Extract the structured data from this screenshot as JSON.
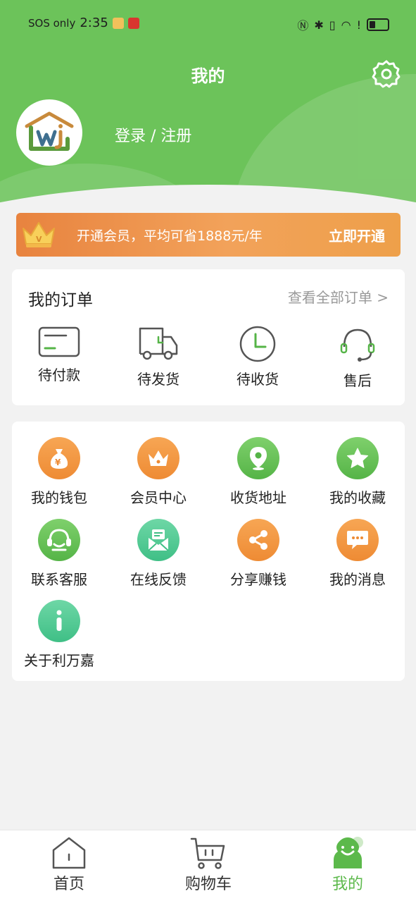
{
  "status_bar": {
    "carrier": "SOS only",
    "time": "2:35"
  },
  "header": {
    "title": "我的",
    "login_text": "登录 / 注册",
    "settings_icon": "gear-icon",
    "avatar_logo": "liwanjia-logo"
  },
  "vip_banner": {
    "promo": "开通会员，平均可省1888元/年",
    "action": "立即开通",
    "icon": "crown-icon"
  },
  "orders": {
    "title": "我的订单",
    "view_all": "查看全部订单 >",
    "items": [
      {
        "label": "待付款",
        "icon": "card-icon"
      },
      {
        "label": "待发货",
        "icon": "truck-icon"
      },
      {
        "label": "待收货",
        "icon": "clock-icon"
      },
      {
        "label": "售后",
        "icon": "headset-icon"
      }
    ]
  },
  "tools": [
    {
      "label": "我的钱包",
      "icon": "money-bag-icon",
      "color": "#f29a45"
    },
    {
      "label": "会员中心",
      "icon": "crown-icon",
      "color": "#f29a45"
    },
    {
      "label": "收货地址",
      "icon": "location-pin-icon",
      "color": "#6cc35a"
    },
    {
      "label": "我的收藏",
      "icon": "star-icon",
      "color": "#6cc35a"
    },
    {
      "label": "联系客服",
      "icon": "customer-service-icon",
      "color": "#6cc35a"
    },
    {
      "label": "在线反馈",
      "icon": "feedback-mail-icon",
      "color": "#4fc792"
    },
    {
      "label": "分享赚钱",
      "icon": "share-icon",
      "color": "#f29a45"
    },
    {
      "label": "我的消息",
      "icon": "message-icon",
      "color": "#f29a45"
    },
    {
      "label": "关于利万嘉",
      "icon": "info-icon",
      "color": "#4fc792"
    }
  ],
  "bottom_nav": [
    {
      "label": "首页",
      "icon": "home-icon",
      "active": false
    },
    {
      "label": "购物车",
      "icon": "cart-icon",
      "active": false
    },
    {
      "label": "我的",
      "icon": "profile-icon",
      "active": true
    }
  ],
  "colors": {
    "brand_green": "#6cc35a",
    "accent_orange": "#ee8b34",
    "active_nav": "#5cb94b"
  }
}
